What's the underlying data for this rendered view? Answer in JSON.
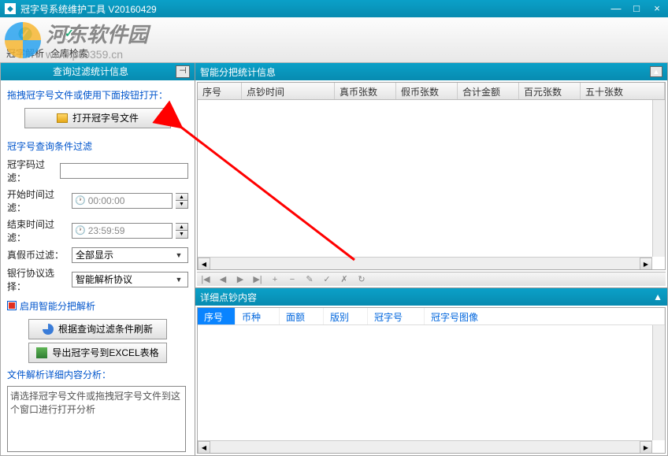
{
  "window": {
    "title": "冠字号系统维护工具 V20160429"
  },
  "watermark": {
    "name": "河东软件园",
    "url": "www.pc0359.cn"
  },
  "toolbar": {
    "parse": "冠字解析",
    "search": "全库检索"
  },
  "left": {
    "panel_title": "查询过滤统计信息",
    "drag_hint": "拖拽冠字号文件或使用下面按钮打开：",
    "open_button": "打开冠字号文件",
    "filter_title": "冠字号查询条件过滤",
    "code_label": "冠字码过滤：",
    "start_label": "开始时间过滤：",
    "start_value": "00:00:00",
    "end_label": "结束时间过滤：",
    "end_value": "23:59:59",
    "real_label": "真假币过滤：",
    "real_value": "全部显示",
    "bank_label": "银行协议选择：",
    "bank_value": "智能解析协议",
    "chk_label": "启用智能分把解析",
    "refresh_button": "根据查询过滤条件刷新",
    "export_button": "导出冠字号到EXCEL表格",
    "detail_title": "文件解析详细内容分析：",
    "detail_text": "请选择冠字号文件或拖拽冠字号文件到这个窗口进行打开分析"
  },
  "right_top": {
    "panel_title": "智能分把统计信息",
    "columns": [
      "序号",
      "点钞时间",
      "真币张数",
      "假币张数",
      "合计金额",
      "百元张数",
      "五十张数"
    ]
  },
  "right_bottom": {
    "panel_title": "详细点钞内容",
    "columns": [
      "序号",
      "币种",
      "面额",
      "版别",
      "冠字号",
      "冠字号图像"
    ]
  }
}
